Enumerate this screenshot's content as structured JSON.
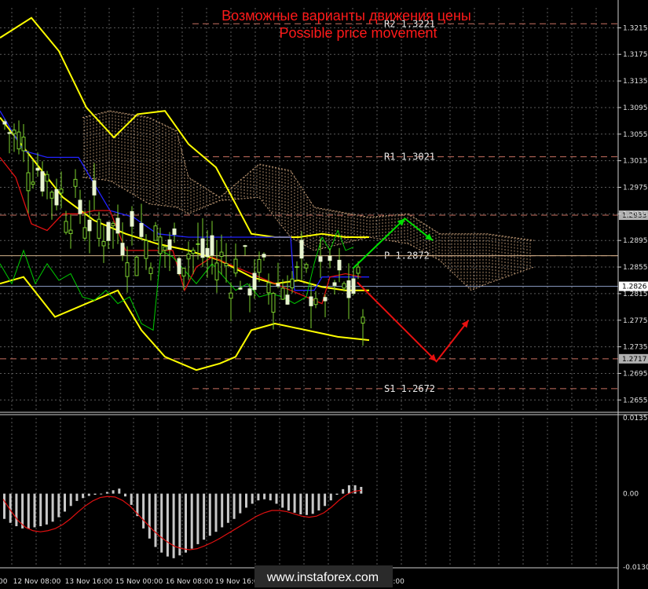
{
  "chart_data": [
    {
      "type": "candlestick",
      "title": "Возможные варианты движения цены",
      "subtitle": "Possible price movement",
      "ylim": [
        1.264,
        1.3245
      ],
      "y_ticks": [
        "1.3215",
        "1.3175",
        "1.3135",
        "1.3095",
        "1.3055",
        "1.3015",
        "1.2975",
        "1.2935",
        "1.2895",
        "1.2855",
        "1.2815",
        "1.2775",
        "1.2735",
        "1.2695",
        "1.2655"
      ],
      "x_ticks": [
        "00",
        "12 Nov 08:00",
        "13 Nov 16:00",
        "15 Nov 00:00",
        "16 Nov 08:00",
        "19 Nov 16:00",
        "",
        "ov 16:00"
      ],
      "levels": [
        {
          "label": "R2 1.3221",
          "value": 1.3221
        },
        {
          "label": "R1 1.3021",
          "value": 1.3021
        },
        {
          "label": "P 1.2872",
          "value": 1.2872
        },
        {
          "label": "S1 1.2672",
          "value": 1.2672
        }
      ],
      "price_markers": [
        {
          "label": "1.2933",
          "value": 1.2933,
          "color": "#b0b0b0",
          "text_color": "#000000"
        },
        {
          "label": "1.2826",
          "value": 1.2826,
          "color": "#ffffff",
          "text_color": "#000000"
        },
        {
          "label": "1.2717",
          "value": 1.2717,
          "color": "#b0b0b0",
          "text_color": "#000000"
        }
      ],
      "forecast_up": [
        [
          0.571,
          1.2853
        ],
        [
          0.655,
          1.2928
        ],
        [
          0.7,
          1.2895
        ]
      ],
      "forecast_down": [
        [
          0.578,
          1.2832
        ],
        [
          0.706,
          1.2713
        ],
        [
          0.758,
          1.2775
        ]
      ],
      "colors": {
        "up_arrow": "#00e000",
        "down_arrow": "#e81010",
        "bands": "#ffff00",
        "kijun": "#2222ff",
        "tenkan": "#dd1111",
        "chikou": "#00cc00",
        "candle": "#7ccf2e",
        "cloud": "#c8a07a"
      }
    },
    {
      "type": "histogram",
      "title": "",
      "ylim": [
        -0.01307,
        0.01351
      ],
      "y_ticks": [
        "0.01351",
        "0.00",
        "-0.01307"
      ],
      "values": [
        -0.0045,
        -0.0052,
        -0.0058,
        -0.0062,
        -0.0063,
        -0.006,
        -0.0058,
        -0.0055,
        -0.005,
        -0.0042,
        -0.0032,
        -0.0022,
        -0.0013,
        -0.0008,
        -0.0004,
        -0.0002,
        0.0,
        0.0003,
        0.0006,
        0.0009,
        -0.0005,
        -0.002,
        -0.004,
        -0.0062,
        -0.008,
        -0.0095,
        -0.0105,
        -0.0112,
        -0.0115,
        -0.011,
        -0.0105,
        -0.0098,
        -0.009,
        -0.0082,
        -0.0075,
        -0.0068,
        -0.006,
        -0.0052,
        -0.0045,
        -0.0035,
        -0.0025,
        -0.0018,
        -0.0012,
        -0.001,
        -0.0012,
        -0.0018,
        -0.0025,
        -0.003,
        -0.0034,
        -0.0037,
        -0.0038,
        -0.0036,
        -0.003,
        -0.0022,
        -0.0012,
        -0.0002,
        0.0008,
        0.0015,
        0.0015,
        0.0012
      ],
      "signal": [
        -0.001,
        -0.003,
        -0.0048,
        -0.006,
        -0.0066,
        -0.0068,
        -0.0066,
        -0.0062,
        -0.0055,
        -0.0045,
        -0.0033,
        -0.0022,
        -0.0013,
        -0.0007,
        -0.0005,
        -0.0006,
        -0.0012,
        -0.0022,
        -0.0036,
        -0.005,
        -0.0064,
        -0.0076,
        -0.0086,
        -0.0094,
        -0.0098,
        -0.01,
        -0.0098,
        -0.0093,
        -0.0087,
        -0.008,
        -0.0072,
        -0.0064,
        -0.0056,
        -0.0048,
        -0.004,
        -0.0034,
        -0.003,
        -0.003,
        -0.0032,
        -0.0036,
        -0.004,
        -0.0042,
        -0.004,
        -0.0034,
        -0.0024,
        -0.0012,
        -0.0002,
        0.0004,
        0.0006
      ]
    }
  ],
  "watermark": "www.instaforex.com"
}
